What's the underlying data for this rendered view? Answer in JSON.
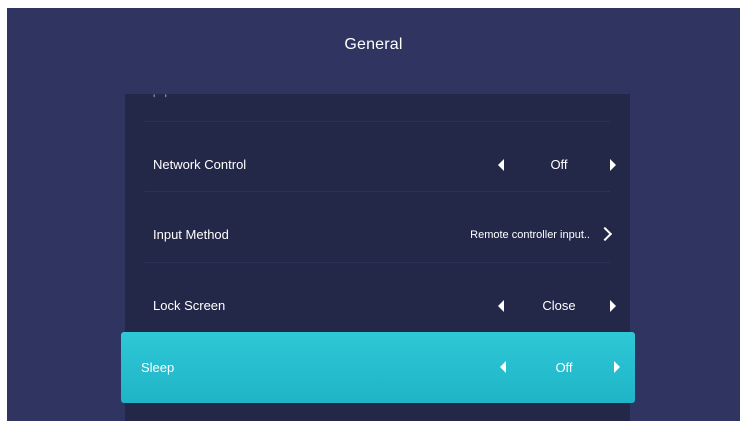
{
  "header": {
    "title": "General"
  },
  "list": {
    "partial_item_label": "' '",
    "items": [
      {
        "label": "Network Control",
        "value": "Off",
        "type": "switcher"
      },
      {
        "label": "Input Method",
        "value": "Remote controller input..",
        "type": "submenu"
      },
      {
        "label": "Lock Screen",
        "value": "Close",
        "type": "switcher"
      },
      {
        "label": "Sleep",
        "value": "Off",
        "type": "switcher",
        "selected": true
      }
    ]
  },
  "icons": {
    "left": "triangle-left-icon",
    "right": "triangle-right-icon",
    "chevron": "chevron-right-icon"
  },
  "colors": {
    "background": "#2f3460",
    "list_background": "#232848",
    "selected_gradient_top": "#2ec8d6",
    "selected_gradient_bottom": "#1fb4c7",
    "text": "#ffffff"
  }
}
